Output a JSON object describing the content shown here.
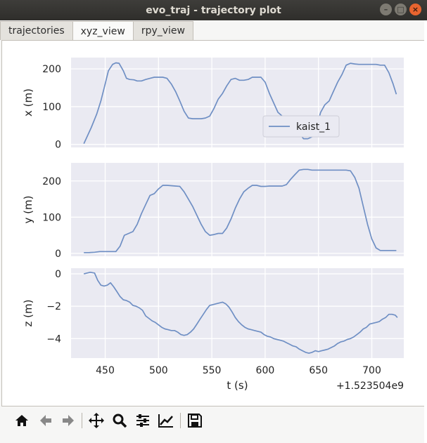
{
  "window": {
    "title": "evo_traj - trajectory plot",
    "controls": [
      "minimize-icon",
      "maximize-icon",
      "close-icon"
    ]
  },
  "tabs": [
    {
      "label": "trajectories"
    },
    {
      "label": "xyz_view",
      "active": true
    },
    {
      "label": "rpy_view"
    }
  ],
  "toolbar": {
    "buttons": [
      "home-icon",
      "back-arrow-icon",
      "forward-arrow-icon",
      "pan-icon",
      "zoom-icon",
      "configure-subplots-icon",
      "edit-axis-icon",
      "save-icon"
    ]
  },
  "colors": {
    "plot_background": "#eaeaf2",
    "series_line": "#6f8fc4",
    "grid": "#ffffff"
  },
  "chart_data": [
    {
      "type": "line",
      "ylabel": "x (m)",
      "yticks": [
        "0",
        "100",
        "200"
      ],
      "ylim": [
        -8,
        230
      ],
      "xlim": [
        418,
        730
      ],
      "legend": {
        "entries": [
          "kaist_1"
        ],
        "placement": "right"
      },
      "series": [
        {
          "name": "kaist_1",
          "x": [
            430,
            433,
            437,
            442,
            446,
            450,
            453,
            457,
            460,
            463,
            467,
            470,
            473,
            477,
            480,
            484,
            488,
            492,
            496,
            500,
            504,
            508,
            512,
            516,
            520,
            524,
            528,
            532,
            536,
            540,
            544,
            548,
            552,
            556,
            560,
            564,
            568,
            572,
            576,
            580,
            584,
            588,
            592,
            596,
            600,
            604,
            608,
            612,
            616,
            620,
            624,
            628,
            632,
            636,
            640,
            644,
            648,
            652,
            656,
            660,
            664,
            668,
            672,
            676,
            680,
            684,
            688,
            692,
            696,
            700,
            704,
            708,
            712,
            716,
            720,
            723
          ],
          "values": [
            2,
            20,
            45,
            80,
            115,
            160,
            195,
            212,
            216,
            215,
            195,
            175,
            172,
            171,
            168,
            168,
            172,
            175,
            178,
            178,
            178,
            175,
            160,
            140,
            115,
            88,
            70,
            68,
            68,
            68,
            70,
            75,
            95,
            120,
            135,
            155,
            172,
            175,
            170,
            170,
            172,
            178,
            178,
            178,
            165,
            135,
            110,
            85,
            75,
            65,
            55,
            45,
            30,
            15,
            15,
            20,
            45,
            85,
            105,
            115,
            140,
            165,
            185,
            210,
            215,
            213,
            212,
            212,
            212,
            212,
            212,
            210,
            210,
            190,
            160,
            133
          ]
        }
      ]
    },
    {
      "type": "line",
      "ylabel": "y (m)",
      "yticks": [
        "0",
        "100",
        "200"
      ],
      "ylim": [
        -8,
        250
      ],
      "xlim": [
        418,
        730
      ],
      "series": [
        {
          "name": "kaist_1",
          "x": [
            430,
            435,
            440,
            445,
            450,
            455,
            460,
            464,
            468,
            472,
            476,
            480,
            484,
            488,
            492,
            496,
            500,
            504,
            508,
            512,
            516,
            520,
            524,
            528,
            532,
            536,
            540,
            544,
            548,
            552,
            556,
            560,
            564,
            568,
            572,
            576,
            580,
            584,
            588,
            592,
            596,
            600,
            604,
            608,
            612,
            616,
            620,
            624,
            628,
            632,
            636,
            640,
            644,
            648,
            652,
            656,
            660,
            664,
            668,
            672,
            676,
            680,
            684,
            688,
            692,
            696,
            700,
            704,
            708,
            712,
            716,
            720,
            723
          ],
          "values": [
            2,
            2,
            3,
            5,
            5,
            5,
            5,
            20,
            50,
            55,
            60,
            80,
            110,
            135,
            160,
            165,
            178,
            188,
            188,
            187,
            186,
            185,
            170,
            150,
            130,
            105,
            80,
            60,
            50,
            52,
            55,
            55,
            70,
            95,
            125,
            150,
            170,
            180,
            188,
            188,
            185,
            185,
            186,
            186,
            186,
            186,
            190,
            205,
            218,
            230,
            232,
            232,
            230,
            230,
            230,
            230,
            230,
            230,
            230,
            230,
            230,
            228,
            210,
            180,
            130,
            80,
            40,
            15,
            8,
            8,
            8,
            8,
            8
          ]
        }
      ]
    },
    {
      "type": "line",
      "xlabel": "t (s)",
      "ylabel": "z (m)",
      "yticks": [
        "0",
        "−2",
        "−4"
      ],
      "xticks": [
        "450",
        "500",
        "550",
        "600",
        "650",
        "700"
      ],
      "offset_label": "+1.523504e9",
      "ylim": [
        -5.2,
        0.35
      ],
      "xlim": [
        418,
        730
      ],
      "series": [
        {
          "name": "kaist_1",
          "x": [
            430,
            433,
            436,
            440,
            443,
            446,
            449,
            452,
            455,
            458,
            461,
            464,
            467,
            470,
            473,
            476,
            479,
            482,
            485,
            488,
            491,
            494,
            497,
            500,
            503,
            506,
            509,
            512,
            515,
            518,
            521,
            524,
            527,
            530,
            533,
            536,
            539,
            542,
            545,
            548,
            551,
            554,
            557,
            560,
            563,
            566,
            569,
            572,
            575,
            578,
            581,
            584,
            587,
            590,
            593,
            596,
            599,
            602,
            605,
            608,
            611,
            614,
            617,
            620,
            623,
            626,
            629,
            632,
            635,
            638,
            641,
            644,
            647,
            650,
            653,
            656,
            659,
            662,
            665,
            668,
            671,
            674,
            677,
            680,
            683,
            686,
            689,
            692,
            695,
            698,
            701,
            704,
            707,
            710,
            713,
            716,
            719,
            722,
            724
          ],
          "values": [
            0,
            0.05,
            0.1,
            0.05,
            -0.4,
            -0.7,
            -0.75,
            -0.7,
            -0.55,
            -0.8,
            -1.1,
            -1.4,
            -1.6,
            -1.65,
            -1.75,
            -1.95,
            -2.0,
            -2.1,
            -2.25,
            -2.6,
            -2.75,
            -2.9,
            -3.0,
            -3.15,
            -3.3,
            -3.4,
            -3.45,
            -3.5,
            -3.5,
            -3.6,
            -3.75,
            -3.8,
            -3.75,
            -3.6,
            -3.4,
            -3.1,
            -2.8,
            -2.5,
            -2.2,
            -1.95,
            -1.9,
            -1.85,
            -1.8,
            -1.75,
            -1.85,
            -2.05,
            -2.35,
            -2.7,
            -2.95,
            -3.15,
            -3.3,
            -3.4,
            -3.45,
            -3.5,
            -3.55,
            -3.6,
            -3.75,
            -3.85,
            -3.9,
            -4.0,
            -4.05,
            -4.1,
            -4.15,
            -4.25,
            -4.35,
            -4.45,
            -4.5,
            -4.65,
            -4.75,
            -4.85,
            -4.9,
            -4.85,
            -4.75,
            -4.8,
            -4.75,
            -4.7,
            -4.65,
            -4.55,
            -4.45,
            -4.3,
            -4.2,
            -4.15,
            -4.05,
            -4.0,
            -3.9,
            -3.75,
            -3.6,
            -3.4,
            -3.3,
            -3.1,
            -3.05,
            -3.0,
            -2.95,
            -2.8,
            -2.7,
            -2.5,
            -2.5,
            -2.55,
            -2.7
          ]
        }
      ]
    }
  ]
}
